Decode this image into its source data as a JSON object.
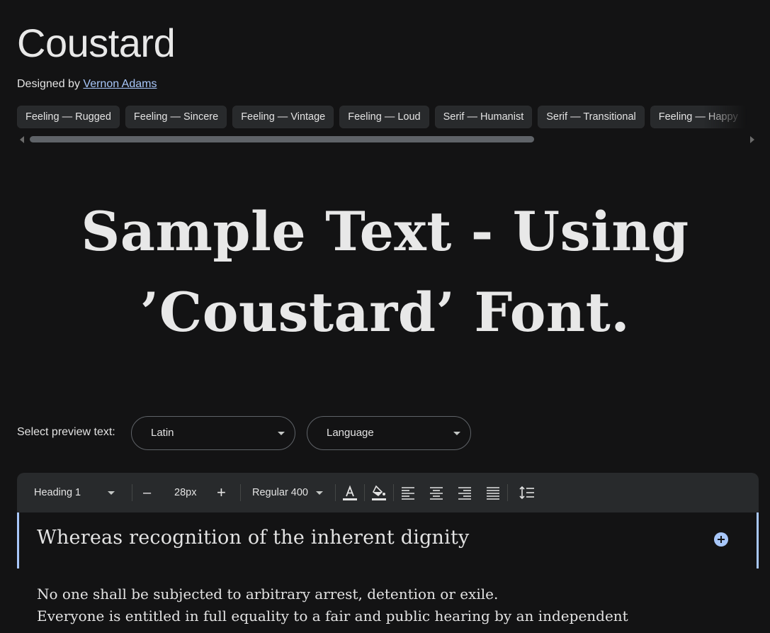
{
  "font": {
    "name": "Coustard",
    "designed_by_label": "Designed by",
    "designer": "Vernon Adams"
  },
  "tags": [
    "Feeling — Rugged",
    "Feeling — Sincere",
    "Feeling — Vintage",
    "Feeling — Loud",
    "Serif — Humanist",
    "Serif — Transitional",
    "Feeling — Happy"
  ],
  "sample": {
    "line1": "Sample Text - Using",
    "line2": "’Coustard’ Font."
  },
  "preview": {
    "label": "Select preview text:",
    "script_select": "Latin",
    "language_select": "Language"
  },
  "toolbar": {
    "style_select": "Heading 1",
    "decrease_label": "–",
    "size_value": "28px",
    "increase_label": "+",
    "weight_select": "Regular 400",
    "icons": [
      "text-color-icon",
      "highlight-color-icon",
      "align-left-icon",
      "align-center-icon",
      "align-right-icon",
      "align-justify-icon",
      "line-height-icon"
    ]
  },
  "editor": {
    "heading": "Whereas recognition of the inherent dignity",
    "body_lines": [
      "No one shall be subjected to arbitrary arrest, detention or exile.",
      "Everyone is entitled in full equality to a fair and public hearing by an independent"
    ]
  },
  "colors": {
    "background": "#131314",
    "chip_bg": "#282a2c",
    "link": "#a8c7fa",
    "accent": "#a8c7fa"
  }
}
